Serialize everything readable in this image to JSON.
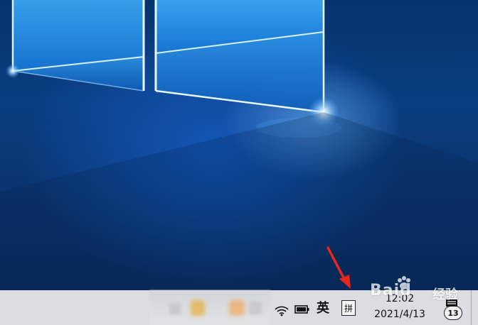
{
  "taskbar": {
    "input_language": "英",
    "ime_mode": "拼",
    "clock": {
      "time": "12:02",
      "date": "2021/4/13"
    },
    "notification_count": "13"
  },
  "tray_icons": [
    "wifi-icon",
    "battery-icon"
  ],
  "watermark": {
    "text": "Baid",
    "sub": "经验"
  },
  "colors": {
    "taskbar_bg": "#dcdde0",
    "annotation_arrow": "#e8261b",
    "desktop_blue": "#0a3e80"
  }
}
